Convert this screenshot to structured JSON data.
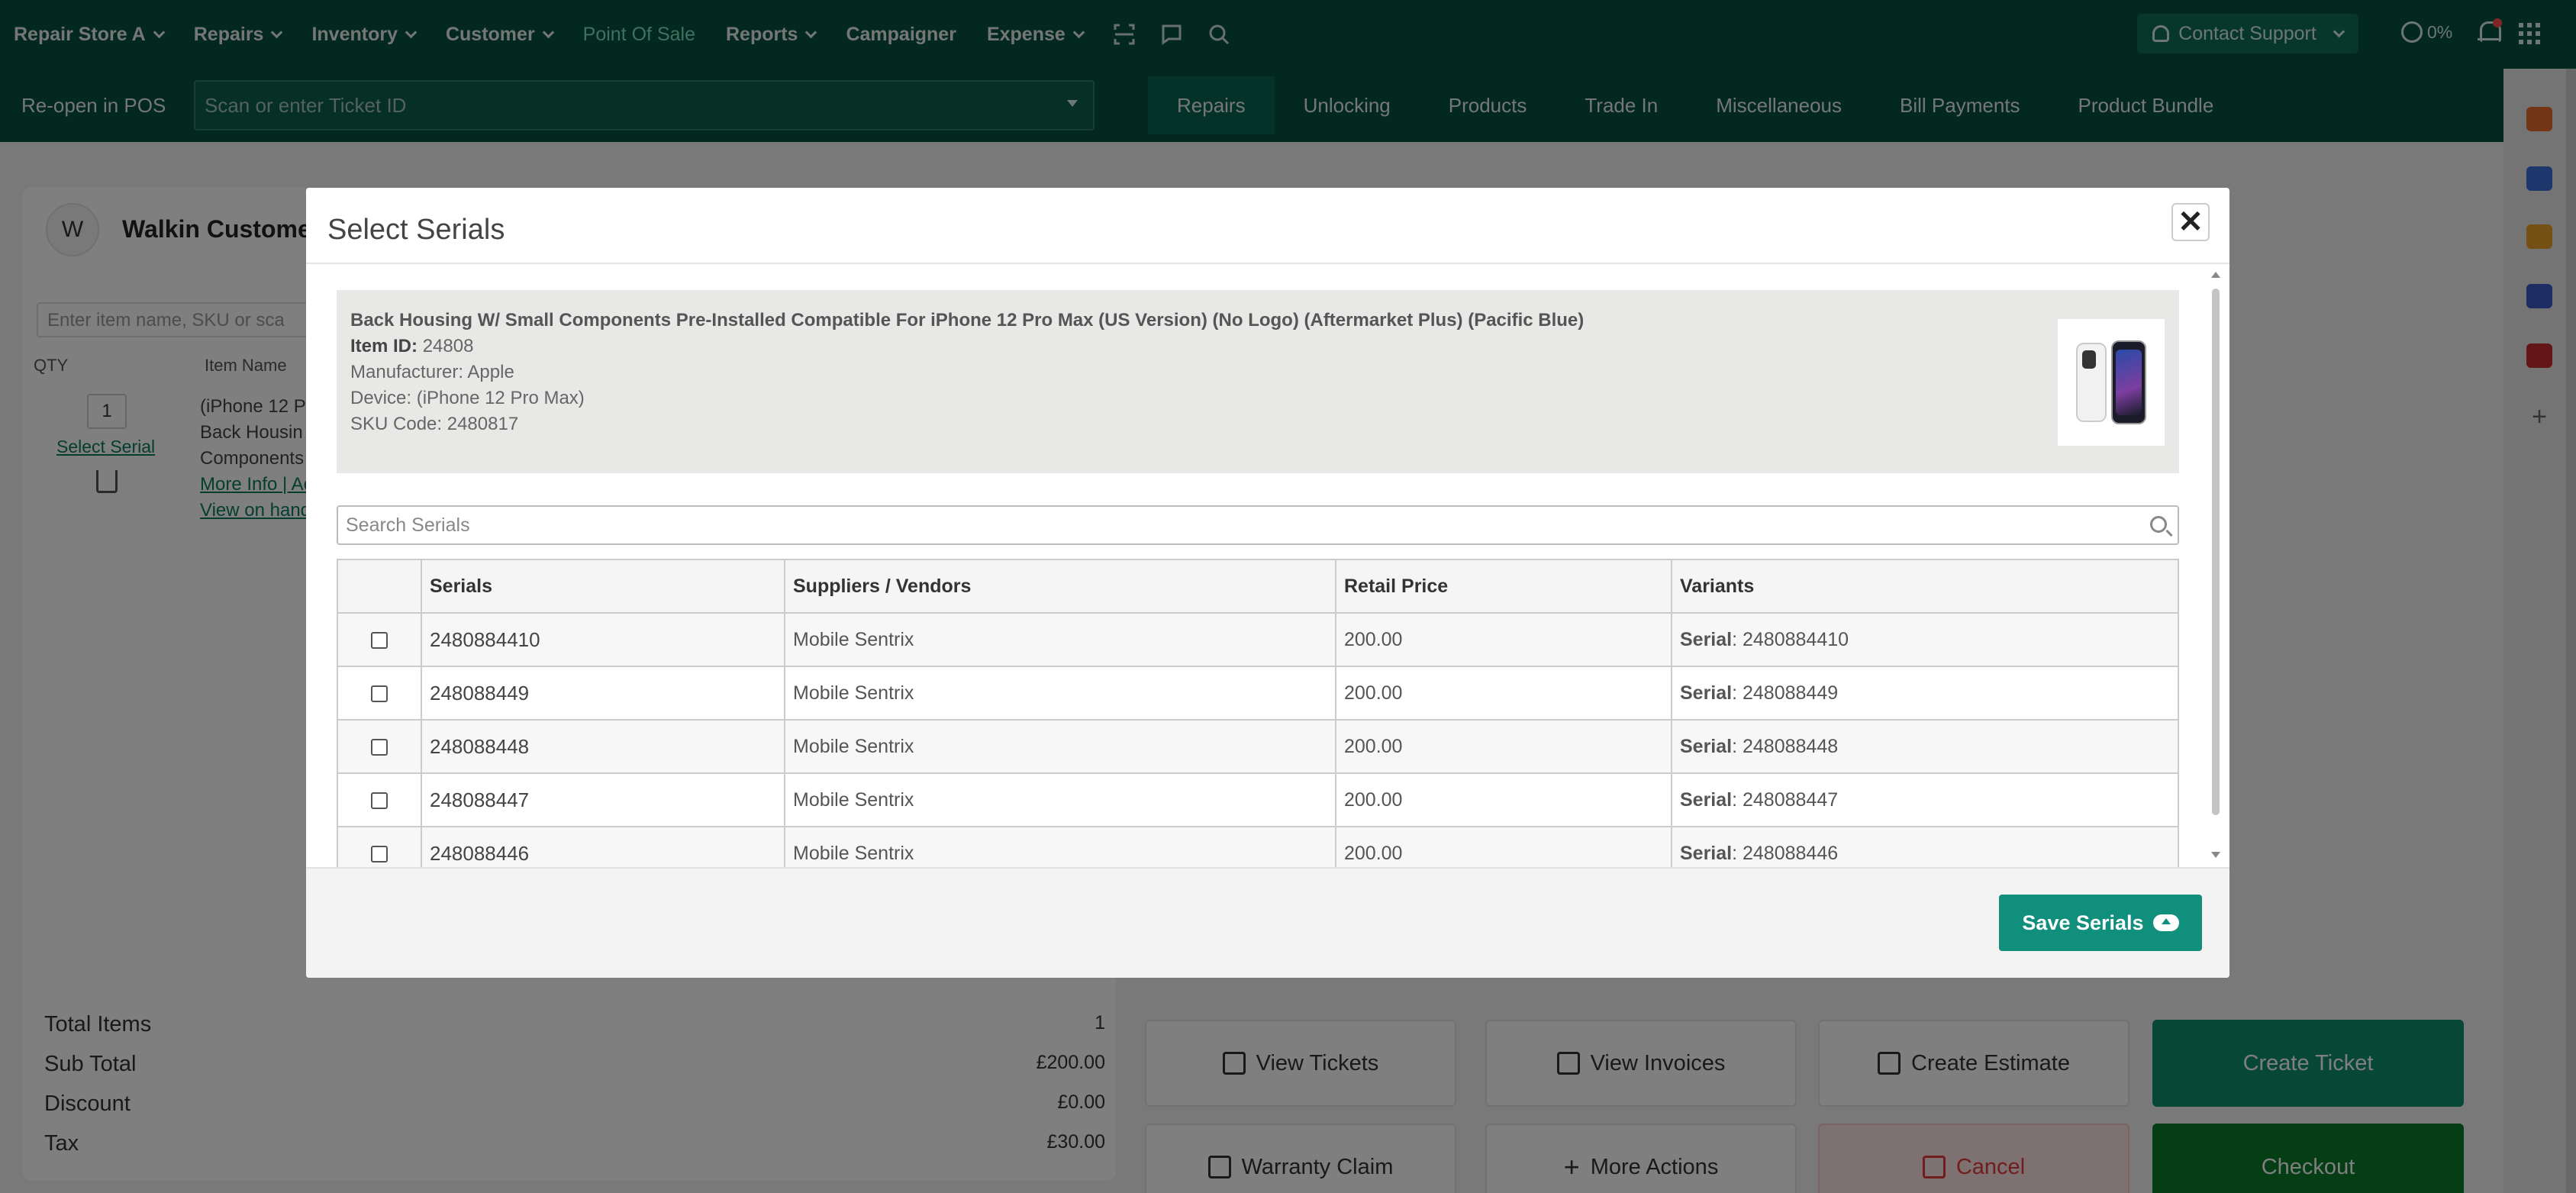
{
  "topnav": {
    "items": [
      {
        "label": "Repair Store A",
        "dropdown": true
      },
      {
        "label": "Repairs",
        "dropdown": true
      },
      {
        "label": "Inventory",
        "dropdown": true
      },
      {
        "label": "Customer",
        "dropdown": true
      },
      {
        "label": "Point Of Sale",
        "dropdown": false,
        "active": true
      },
      {
        "label": "Reports",
        "dropdown": true
      },
      {
        "label": "Campaigner",
        "dropdown": false
      },
      {
        "label": "Expense",
        "dropdown": true
      }
    ],
    "icons": [
      "scan-icon",
      "chat-icon",
      "search-icon"
    ],
    "contact_support": "Contact Support",
    "progress": "0%",
    "accent_color": "#06513f",
    "active_color": "#7ee2bf"
  },
  "subbar": {
    "reopen_label": "Re-open in POS",
    "ticket_placeholder": "Scan or enter Ticket ID",
    "tabs": [
      "Repairs",
      "Unlocking",
      "Products",
      "Trade In",
      "Miscellaneous",
      "Bill Payments",
      "Product Bundle"
    ],
    "active_tab": "Repairs"
  },
  "background": {
    "avatar_letter": "W",
    "customer_name": "Walkin Custome",
    "item_search_placeholder": "Enter item name, SKU or sca",
    "col_qty": "QTY",
    "col_item_name": "Item Name",
    "qty": "1",
    "select_serial": "Select Serial",
    "item_line1": "(iPhone 12 P",
    "item_line2": "Back Housin",
    "item_line3": "Components",
    "more_info": "More Info | Ac",
    "view_on_hand": "View on hand",
    "totals": [
      {
        "label": "Total Items",
        "value": "1"
      },
      {
        "label": "Sub Total",
        "value": "£200.00"
      },
      {
        "label": "Discount",
        "value": "£0.00"
      },
      {
        "label": "Tax",
        "value": "£30.00"
      }
    ],
    "actions": {
      "view_tickets": "View Tickets",
      "view_invoices": "View Invoices",
      "create_estimate": "Create Estimate",
      "create_ticket": "Create Ticket",
      "warranty_claim": "Warranty Claim",
      "more_actions": "More Actions",
      "cancel": "Cancel",
      "checkout": "Checkout"
    }
  },
  "modal": {
    "title": "Select Serials",
    "close_glyph": "✕",
    "product": {
      "title": "Back Housing W/ Small Components Pre-Installed Compatible For iPhone 12 Pro Max (US Version) (No Logo) (Aftermarket Plus) (Pacific Blue)",
      "item_id_label": "Item ID:",
      "item_id": "24808",
      "manufacturer": "Manufacturer: Apple",
      "device": "Device: (iPhone 12 Pro Max)",
      "sku": "SKU Code: 2480817"
    },
    "search_placeholder": "Search Serials",
    "columns": [
      "",
      "Serials",
      "Suppliers / Vendors",
      "Retail Price",
      "Variants"
    ],
    "variant_label": "Serial",
    "rows": [
      {
        "serial": "2480884410",
        "supplier": "Mobile Sentrix",
        "price": "200.00",
        "variant": ": 2480884410"
      },
      {
        "serial": "248088449",
        "supplier": "Mobile Sentrix",
        "price": "200.00",
        "variant": ": 248088449"
      },
      {
        "serial": "248088448",
        "supplier": "Mobile Sentrix",
        "price": "200.00",
        "variant": ": 248088448"
      },
      {
        "serial": "248088447",
        "supplier": "Mobile Sentrix",
        "price": "200.00",
        "variant": ": 248088447"
      },
      {
        "serial": "248088446",
        "supplier": "Mobile Sentrix",
        "price": "200.00",
        "variant": ": 248088446"
      }
    ],
    "save_label": "Save Serials",
    "save_color": "#0f8f7c"
  }
}
